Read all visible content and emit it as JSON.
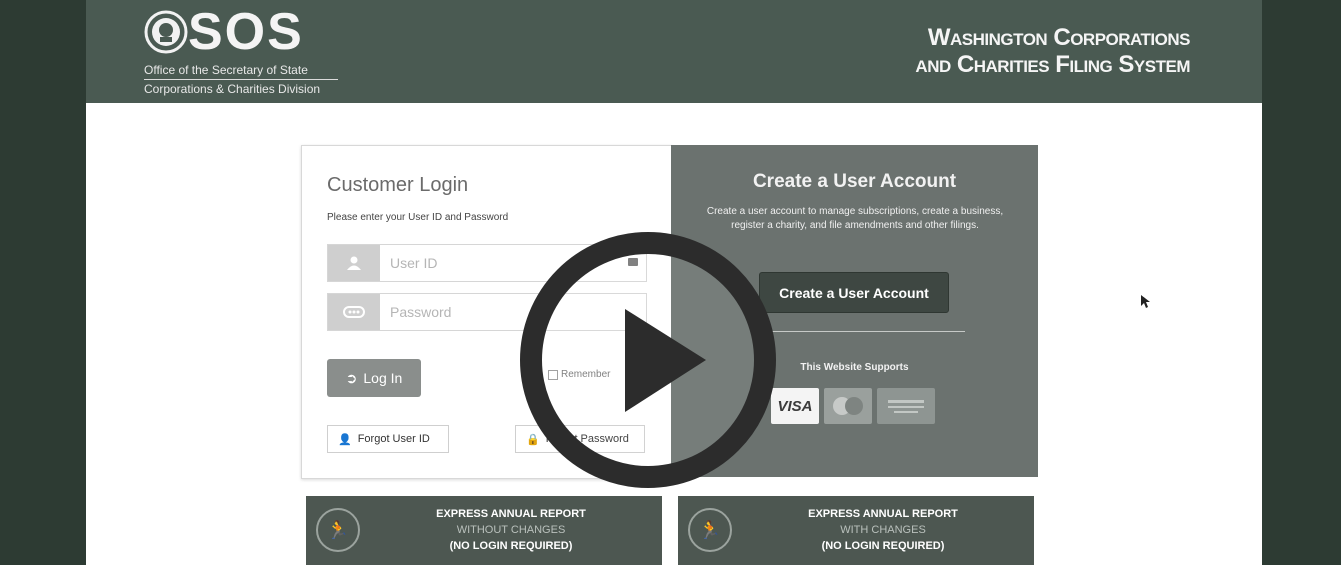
{
  "header": {
    "logo_word": "SOS",
    "logo_sub1": "Office of the Secretary of State",
    "logo_sub2": "Corporations & Charities Division",
    "system_title_line1": "Washington Corporations",
    "system_title_line2": "and Charities Filing System"
  },
  "login": {
    "title": "Customer Login",
    "instructions": "Please enter your User ID and Password",
    "user_id_placeholder": "User ID",
    "password_placeholder": "Password",
    "login_button": "Log In",
    "remember_label": "Remember",
    "forgot_user_id": "Forgot User ID",
    "forgot_password": "Forgot Password"
  },
  "create_account": {
    "title": "Create a User Account",
    "description": "Create a user account to manage subscriptions, create a business, register a charity, and file amendments and other filings.",
    "button": "Create a User Account",
    "supports_label": "This Website Supports",
    "card_visa": "VISA"
  },
  "tiles": [
    {
      "line1": "EXPRESS ANNUAL REPORT",
      "line2": "WITHOUT CHANGES",
      "line3": "(NO LOGIN REQUIRED)"
    },
    {
      "line1": "EXPRESS ANNUAL REPORT",
      "line2": "WITH CHANGES",
      "line3": "(NO LOGIN REQUIRED)"
    }
  ],
  "icons": {
    "seal": "state-seal-icon",
    "user": "user-icon",
    "password": "password-icon",
    "login": "login-arrow-icon",
    "lock": "lock-icon",
    "runner": "runner-icon",
    "play": "play-icon",
    "cursor": "mouse-cursor-icon"
  },
  "colors": {
    "header_bg": "#4a5a52",
    "create_card_bg": "#6b726f",
    "tile_bg": "#4d5751",
    "frame_bg": "#2d3b33"
  }
}
